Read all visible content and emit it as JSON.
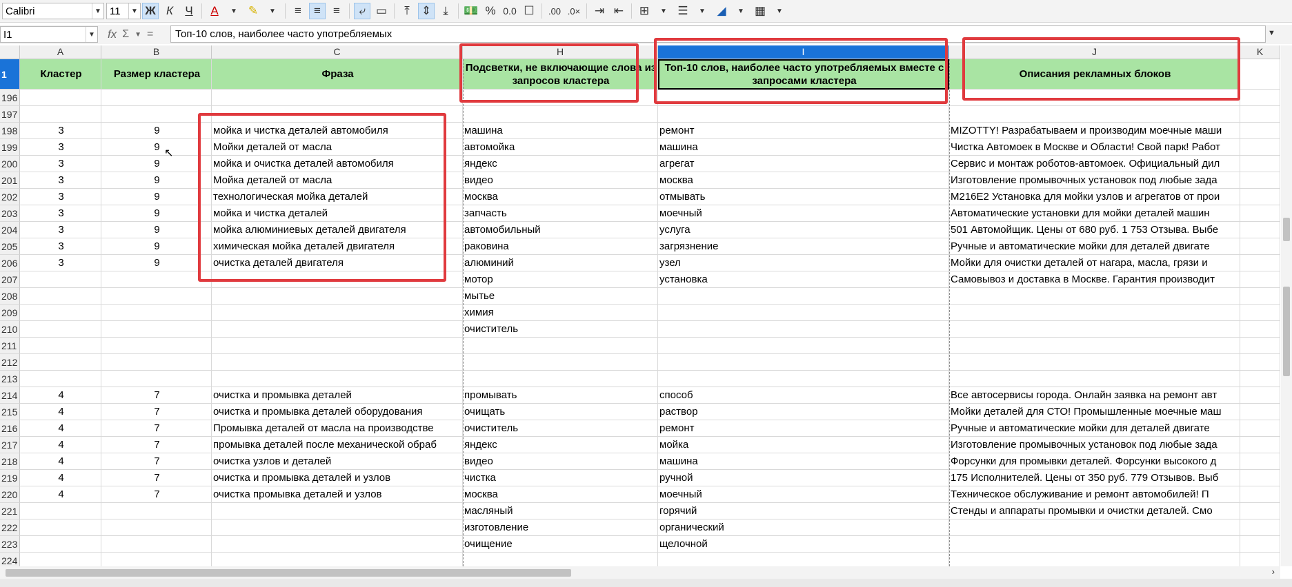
{
  "toolbar": {
    "font_name": "Calibri",
    "font_size": "11",
    "bold": "Ж",
    "italic": "К",
    "underline": "Ч",
    "font_color": "A",
    "percent": "%",
    "decimal": "0.0"
  },
  "formula_bar": {
    "name_box": "I1",
    "fx": "fx",
    "sum": "Σ",
    "equals": "=",
    "content": "Топ-10 слов, наиболее часто употребляемых"
  },
  "columns": [
    "A",
    "B",
    "C",
    "H",
    "I",
    "J",
    "K"
  ],
  "header_row": {
    "row_num": "1",
    "A": "Кластер",
    "B": "Размер кластера",
    "C": "Фраза",
    "H": "Подсветки, не включающие слова из запросов кластера",
    "I": "Топ-10 слов, наиболее часто употребляемых вместе с запросами кластера",
    "J": "Описания рекламных блоков"
  },
  "rows": [
    {
      "n": "196",
      "A": "",
      "B": "",
      "C": "",
      "H": "",
      "I": "",
      "J": ""
    },
    {
      "n": "197",
      "A": "",
      "B": "",
      "C": "",
      "H": "",
      "I": "",
      "J": ""
    },
    {
      "n": "198",
      "A": "3",
      "B": "9",
      "C": "мойка и чистка деталей автомобиля",
      "H": "машина",
      "I": "ремонт",
      "J": "MIZOTTY! Разрабатываем и производим моечные маши"
    },
    {
      "n": "199",
      "A": "3",
      "B": "9",
      "C": "Мойки деталей от масла",
      "H": "автомойка",
      "I": "машина",
      "J": "Чистка Автомоек в Москве и Области! Свой парк! Работ"
    },
    {
      "n": "200",
      "A": "3",
      "B": "9",
      "C": "мойка и очистка деталей автомобиля",
      "H": "яндекс",
      "I": "агрегат",
      "J": "Сервис и монтаж роботов-автомоек. Официальный дил"
    },
    {
      "n": "201",
      "A": "3",
      "B": "9",
      "C": "Мойка деталей от масла",
      "H": "видео",
      "I": "москва",
      "J": "Изготовление промывочных установок под любые зада"
    },
    {
      "n": "202",
      "A": "3",
      "B": "9",
      "C": "технологическая мойка деталей",
      "H": "москва",
      "I": "отмывать",
      "J": "M216E2 Установка для мойки узлов и агрегатов от прои"
    },
    {
      "n": "203",
      "A": "3",
      "B": "9",
      "C": "мойка и чистка деталей",
      "H": "запчасть",
      "I": "моечный",
      "J": "Автоматические установки для мойки деталей машин"
    },
    {
      "n": "204",
      "A": "3",
      "B": "9",
      "C": "мойка алюминиевых деталей двигателя",
      "H": "автомобильный",
      "I": "услуга",
      "J": "501 Автомойщик. Цены от 680 руб. 1 753 Отзыва. Выбе"
    },
    {
      "n": "205",
      "A": "3",
      "B": "9",
      "C": "химическая мойка деталей двигателя",
      "H": "раковина",
      "I": "загрязнение",
      "J": "Ручные и автоматические мойки для деталей двигате"
    },
    {
      "n": "206",
      "A": "3",
      "B": "9",
      "C": "очистка деталей двигателя",
      "H": "алюминий",
      "I": "узел",
      "J": "Мойки для очистки деталей от нагара, масла, грязи и"
    },
    {
      "n": "207",
      "A": "",
      "B": "",
      "C": "",
      "H": "мотор",
      "I": "установка",
      "J": "Самовывоз и доставка в Москве. Гарантия производит"
    },
    {
      "n": "208",
      "A": "",
      "B": "",
      "C": "",
      "H": "мытье",
      "I": "",
      "J": ""
    },
    {
      "n": "209",
      "A": "",
      "B": "",
      "C": "",
      "H": "химия",
      "I": "",
      "J": ""
    },
    {
      "n": "210",
      "A": "",
      "B": "",
      "C": "",
      "H": "очиститель",
      "I": "",
      "J": ""
    },
    {
      "n": "211",
      "A": "",
      "B": "",
      "C": "",
      "H": "",
      "I": "",
      "J": ""
    },
    {
      "n": "212",
      "A": "",
      "B": "",
      "C": "",
      "H": "",
      "I": "",
      "J": ""
    },
    {
      "n": "213",
      "A": "",
      "B": "",
      "C": "",
      "H": "",
      "I": "",
      "J": ""
    },
    {
      "n": "214",
      "A": "4",
      "B": "7",
      "C": "очистка и промывка деталей",
      "H": "промывать",
      "I": "способ",
      "J": "Все автосервисы города. Онлайн заявка на ремонт авт"
    },
    {
      "n": "215",
      "A": "4",
      "B": "7",
      "C": "очистка и промывка деталей оборудования",
      "H": "очищать",
      "I": "раствор",
      "J": "Мойки деталей для СТО! Промышленные моечные маш"
    },
    {
      "n": "216",
      "A": "4",
      "B": "7",
      "C": "Промывка деталей от масла на производстве",
      "H": "очиститель",
      "I": "ремонт",
      "J": "Ручные и автоматические мойки для деталей двигате"
    },
    {
      "n": "217",
      "A": "4",
      "B": "7",
      "C": "промывка деталей после механической обраб",
      "H": "яндекс",
      "I": "мойка",
      "J": "Изготовление промывочных установок под любые зада"
    },
    {
      "n": "218",
      "A": "4",
      "B": "7",
      "C": "очистка узлов и деталей",
      "H": "видео",
      "I": "машина",
      "J": "Форсунки для промывки деталей. Форсунки высокого д"
    },
    {
      "n": "219",
      "A": "4",
      "B": "7",
      "C": "очистка и промывка деталей и узлов",
      "H": "чистка",
      "I": "ручной",
      "J": "175 Исполнителей. Цены от 350 руб. 779 Отзывов. Выб"
    },
    {
      "n": "220",
      "A": "4",
      "B": "7",
      "C": "очистка промывка деталей и узлов",
      "H": "москва",
      "I": "моечный",
      "J": "Техническое обслуживание и ремонт автомобилей! П"
    },
    {
      "n": "221",
      "A": "",
      "B": "",
      "C": "",
      "H": "масляный",
      "I": "горячий",
      "J": "Стенды и аппараты промывки и очистки деталей. Смо"
    },
    {
      "n": "222",
      "A": "",
      "B": "",
      "C": "",
      "H": "изготовление",
      "I": "органический",
      "J": ""
    },
    {
      "n": "223",
      "A": "",
      "B": "",
      "C": "",
      "H": "очищение",
      "I": "щелочной",
      "J": ""
    },
    {
      "n": "224",
      "A": "",
      "B": "",
      "C": "",
      "H": "",
      "I": "",
      "J": ""
    }
  ],
  "colors": {
    "header_green": "#a9e4a3",
    "selected_col": "#1a73d8",
    "annotation_red": "#e03a3e"
  }
}
